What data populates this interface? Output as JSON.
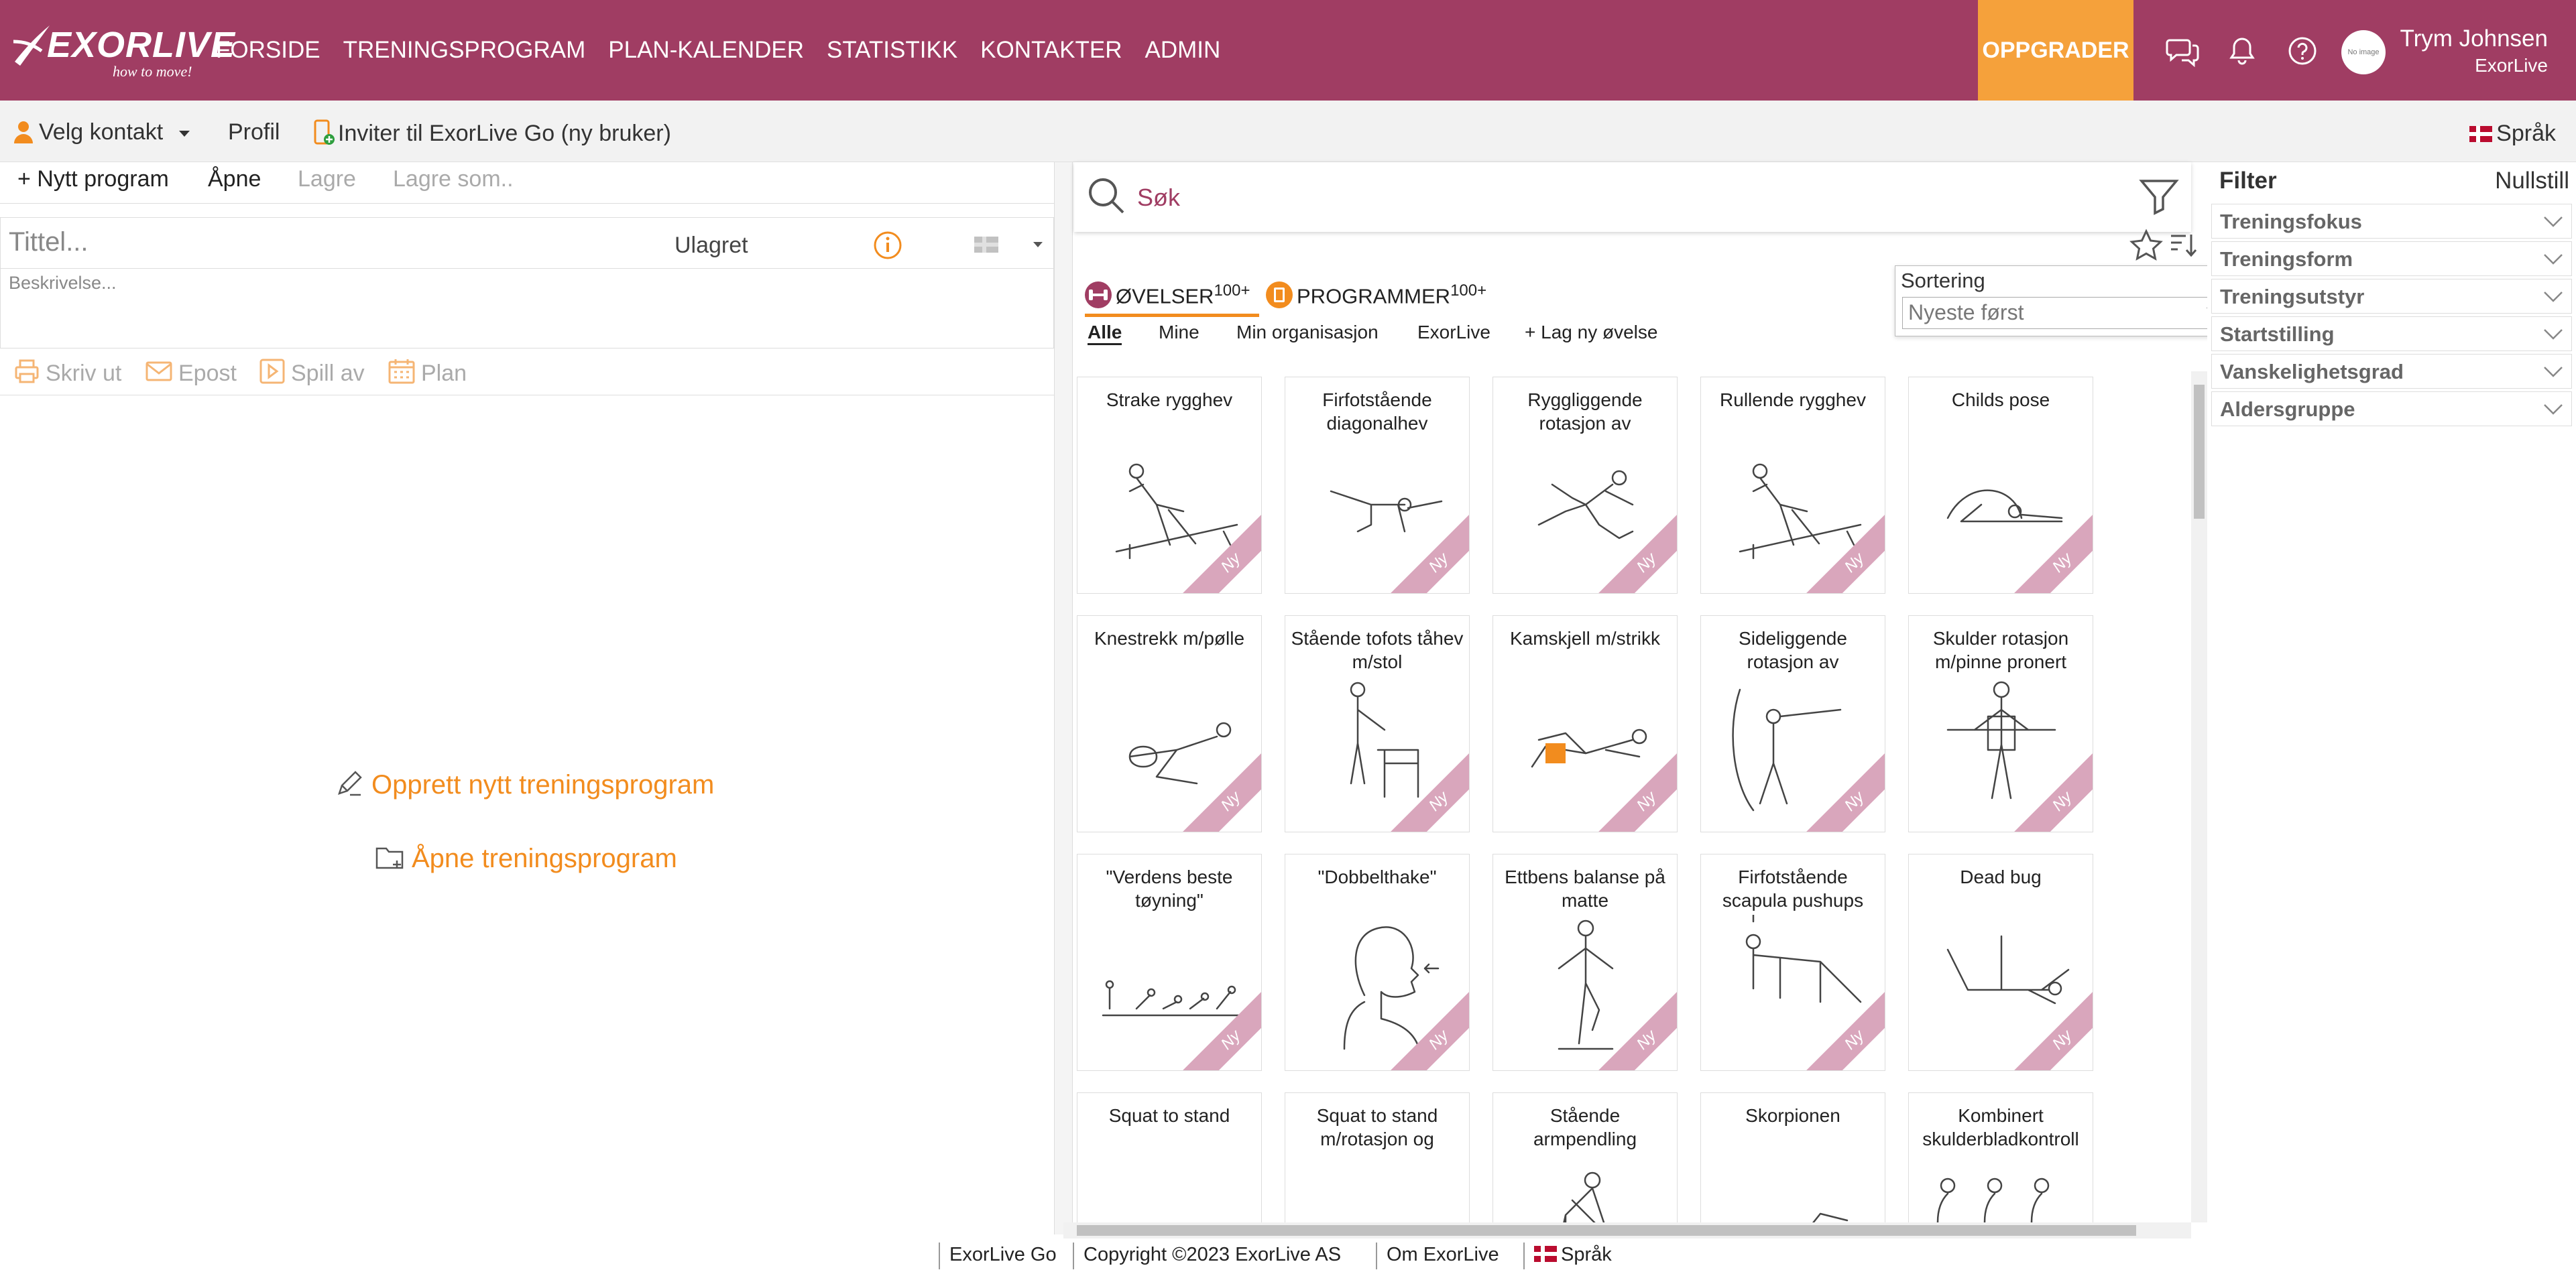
{
  "app": {
    "logo_text": "EXORLIVE",
    "logo_tagline": "how to move!"
  },
  "nav": {
    "items": [
      "FORSIDE",
      "TRENINGSPROGRAM",
      "PLAN-KALENDER",
      "STATISTIKK",
      "KONTAKTER",
      "ADMIN"
    ],
    "active_index": 1,
    "upgrade_label": "OPPGRADER"
  },
  "user": {
    "name": "Trym Johnsen",
    "org": "ExorLive",
    "avatar_text": "No image"
  },
  "subbar": {
    "select_contact": "Velg kontakt",
    "profile": "Profil",
    "invite": "Inviter til ExorLive Go (ny bruker)",
    "language": "Språk"
  },
  "editor": {
    "new_program": "+ Nytt program",
    "open": "Åpne",
    "save": "Lagre",
    "save_as": "Lagre som..",
    "title_placeholder": "Tittel...",
    "status": "Ulagret",
    "description_placeholder": "Beskrivelse...",
    "actions": [
      "Skriv ut",
      "Epost",
      "Spill av",
      "Plan"
    ],
    "create_link": "Opprett nytt treningsprogram",
    "open_link": "Åpne treningsprogram"
  },
  "search": {
    "placeholder": "Søk"
  },
  "sorting": {
    "label": "Sortering",
    "selected": "Nyeste først"
  },
  "library": {
    "tabs": [
      {
        "label": "ØVELSER",
        "count": "100+",
        "color": "#a03d63"
      },
      {
        "label": "PROGRAMMER",
        "count": "100+",
        "color": "#f28c1e"
      }
    ],
    "subtabs": [
      "Alle",
      "Mine",
      "Min organisasjon",
      "ExorLive",
      "+ Lag ny øvelse"
    ],
    "active_subtab": 0,
    "badge": "Ny",
    "exercises": [
      {
        "title": "Strake rygghev",
        "icon": "back-extension-figure"
      },
      {
        "title": "Firfotstående diagonalhev",
        "icon": "bird-dog-figure"
      },
      {
        "title": "Ryggliggende rotasjon av",
        "icon": "supine-rotation-figure"
      },
      {
        "title": "Rullende rygghev",
        "icon": "back-extension-figure"
      },
      {
        "title": "Childs pose",
        "icon": "childs-pose-figure"
      },
      {
        "title": "Knestrekk m/pølle",
        "icon": "knee-extension-figure"
      },
      {
        "title": "Stående tofots tåhev m/stol",
        "icon": "calf-raise-figure"
      },
      {
        "title": "Kamskjell m/strikk",
        "icon": "clamshell-figure"
      },
      {
        "title": "Sideliggende rotasjon av",
        "icon": "side-rotation-figure"
      },
      {
        "title": "Skulder rotasjon m/pinne pronert",
        "icon": "shoulder-rotation-figure"
      },
      {
        "title": "\"Verdens beste tøyning\"",
        "icon": "stretch-sequence-figure"
      },
      {
        "title": "\"Dobbelthake\"",
        "icon": "chin-tuck-figure"
      },
      {
        "title": "Ettbens balanse på matte",
        "icon": "balance-figure"
      },
      {
        "title": "Firfotstående scapula pushups",
        "icon": "scapula-pushup-figure"
      },
      {
        "title": "Dead bug",
        "icon": "dead-bug-figure"
      },
      {
        "title": "Squat to stand",
        "icon": "squat-sequence-figure"
      },
      {
        "title": "Squat to stand m/rotasjon og",
        "icon": "squat-sequence-figure"
      },
      {
        "title": "Stående armpendling",
        "icon": "arm-pendulum-figure"
      },
      {
        "title": "Skorpionen",
        "icon": "scorpion-figure"
      },
      {
        "title": "Kombinert skulderbladkontroll",
        "icon": "scapula-control-figure"
      }
    ]
  },
  "filter": {
    "title": "Filter",
    "reset": "Nullstill",
    "groups": [
      "Treningsfokus",
      "Treningsform",
      "Treningsutstyr",
      "Startstilling",
      "Vanskelighetsgrad",
      "Aldersgruppe"
    ]
  },
  "footer": {
    "items": [
      "ExorLive Go",
      "Copyright ©2023 ExorLive AS",
      "Om ExorLive",
      "Språk"
    ]
  },
  "colors": {
    "brand": "#a03d63",
    "accent": "#f28c1e",
    "upgrade": "#f5a13b",
    "badge": "#d9a6bc"
  }
}
